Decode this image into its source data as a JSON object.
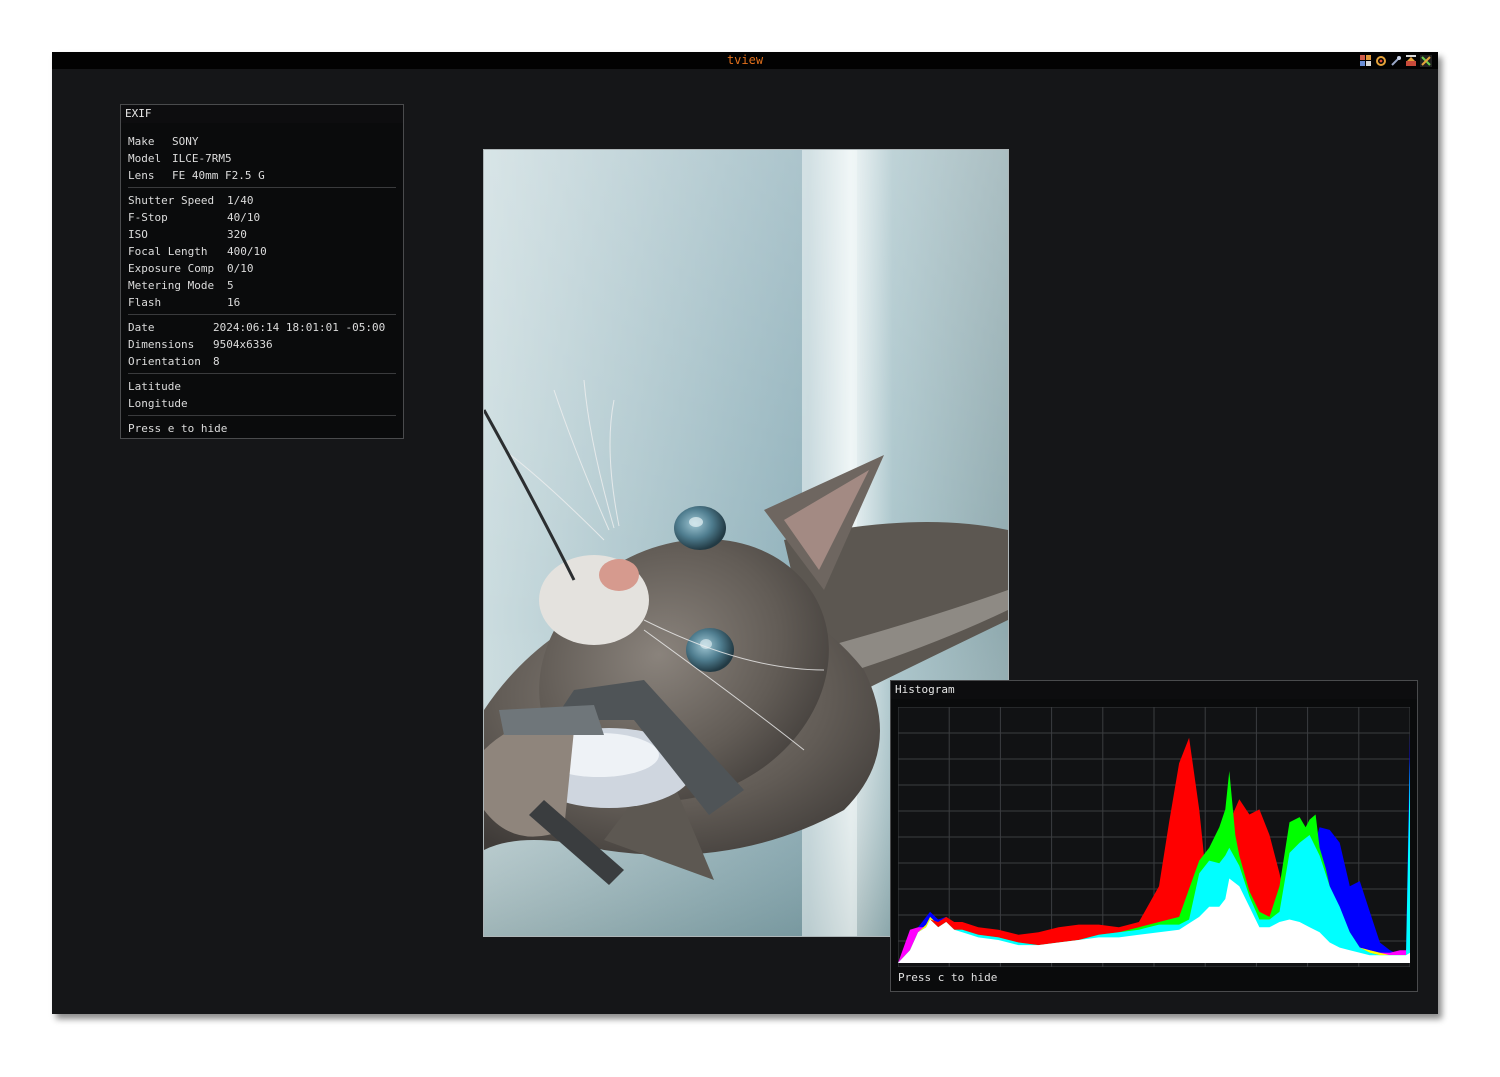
{
  "window": {
    "title": "tview",
    "title_color": "#e2701c",
    "toolbar_icons": [
      "grid-icon",
      "target-icon",
      "pin-icon",
      "maximize-icon",
      "close-icon"
    ]
  },
  "exif": {
    "title": "EXIF",
    "groups": [
      [
        {
          "key": "Make",
          "value": "SONY"
        },
        {
          "key": "Model",
          "value": "ILCE-7RM5"
        },
        {
          "key": "Lens",
          "value": "FE 40mm F2.5 G"
        }
      ],
      [
        {
          "key": "Shutter Speed",
          "value": "1/40"
        },
        {
          "key": "F-Stop",
          "value": "40/10"
        },
        {
          "key": "ISO",
          "value": "320"
        },
        {
          "key": "Focal Length",
          "value": "400/10"
        },
        {
          "key": "Exposure Comp",
          "value": "0/10"
        },
        {
          "key": "Metering Mode",
          "value": "5"
        },
        {
          "key": "Flash",
          "value": "16"
        }
      ],
      [
        {
          "key": "Date",
          "value": "2024:06:14 18:01:01 -05:00"
        },
        {
          "key": "Dimensions",
          "value": "9504x6336"
        },
        {
          "key": "Orientation",
          "value": "8"
        }
      ],
      [
        {
          "key": "Latitude",
          "value": ""
        },
        {
          "key": "Longitude",
          "value": ""
        }
      ]
    ],
    "hint": "Press e to hide"
  },
  "photo": {
    "subject": "cat",
    "colors": {
      "background": "#a9c2c8",
      "fur": "#6b6660",
      "eye": "#4f7d8f",
      "nose": "#d69a8e"
    }
  },
  "histogram": {
    "title": "Histogram",
    "hint": "Press c to hide",
    "chart_data": {
      "type": "area",
      "x_range": [
        0,
        255
      ],
      "y_range": [
        0,
        1
      ],
      "grid": true,
      "series": [
        {
          "color": "#0000ff",
          "x": [
            0,
            6,
            10,
            14,
            16,
            20,
            24,
            28,
            32,
            36,
            40,
            50,
            60,
            70,
            80,
            90,
            100,
            110,
            120,
            130,
            140,
            150,
            160,
            165,
            170,
            175,
            180,
            185,
            190,
            195,
            200,
            205,
            210,
            215,
            220,
            225,
            230,
            235,
            240,
            245,
            250,
            253,
            255
          ],
          "values": [
            0,
            0.06,
            0.14,
            0.18,
            0.2,
            0.17,
            0.18,
            0.15,
            0.15,
            0.14,
            0.13,
            0.11,
            0.09,
            0.08,
            0.09,
            0.1,
            0.12,
            0.12,
            0.13,
            0.15,
            0.15,
            0.22,
            0.35,
            0.36,
            0.4,
            0.55,
            0.54,
            0.46,
            0.3,
            0.3,
            0.32,
            0.4,
            0.53,
            0.52,
            0.47,
            0.3,
            0.32,
            0.2,
            0.08,
            0.05,
            0.03,
            0.04,
            0.9
          ]
        },
        {
          "color": "#ff00ff",
          "x": [
            0,
            6,
            10,
            14,
            16,
            20,
            24,
            28,
            32,
            36,
            40,
            50,
            60,
            70,
            80,
            90,
            100,
            110,
            120,
            130,
            140,
            150,
            160,
            165,
            170,
            175,
            180,
            185,
            190,
            195,
            200,
            205,
            210,
            215,
            220,
            225,
            230,
            235,
            240,
            245,
            250,
            253,
            255
          ],
          "values": [
            0,
            0.13,
            0.14,
            0.14,
            0.17,
            0.14,
            0.16,
            0.13,
            0.13,
            0.12,
            0.11,
            0.1,
            0.08,
            0.07,
            0.08,
            0.09,
            0.11,
            0.11,
            0.12,
            0.14,
            0.14,
            0.18,
            0.3,
            0.32,
            0.36,
            0.37,
            0.35,
            0.32,
            0.24,
            0.2,
            0.18,
            0.17,
            0.16,
            0.15,
            0.13,
            0.1,
            0.06,
            0.05,
            0.04,
            0.04,
            0.05,
            0.05,
            0.1
          ]
        },
        {
          "color": "#ffff00",
          "x": [
            0,
            6,
            10,
            14,
            16,
            20,
            24,
            28,
            32,
            36,
            40,
            50,
            60,
            70,
            80,
            90,
            100,
            110,
            120,
            130,
            140,
            150,
            160,
            165,
            170,
            175,
            180,
            185,
            190,
            195,
            200,
            205,
            210,
            215,
            220,
            225,
            230,
            235,
            240,
            245,
            250,
            253,
            255
          ],
          "values": [
            0,
            0.05,
            0.12,
            0.15,
            0.18,
            0.15,
            0.16,
            0.13,
            0.13,
            0.13,
            0.12,
            0.1,
            0.09,
            0.08,
            0.08,
            0.09,
            0.1,
            0.11,
            0.12,
            0.14,
            0.16,
            0.2,
            0.33,
            0.34,
            0.35,
            0.36,
            0.35,
            0.32,
            0.24,
            0.2,
            0.18,
            0.17,
            0.16,
            0.15,
            0.13,
            0.1,
            0.06,
            0.05,
            0.04,
            0.03,
            0.03,
            0.03,
            0.05
          ]
        },
        {
          "color": "#ff0000",
          "x": [
            0,
            6,
            10,
            14,
            16,
            20,
            24,
            28,
            32,
            36,
            40,
            50,
            60,
            70,
            80,
            90,
            100,
            110,
            120,
            130,
            135,
            140,
            145,
            150,
            152,
            155,
            160,
            165,
            170,
            175,
            180,
            185,
            190,
            195,
            200,
            205,
            210,
            215,
            220,
            225,
            230,
            235,
            240,
            245,
            250,
            253,
            255
          ],
          "values": [
            0,
            0.05,
            0.12,
            0.14,
            0.17,
            0.16,
            0.18,
            0.16,
            0.16,
            0.15,
            0.14,
            0.13,
            0.11,
            0.12,
            0.14,
            0.15,
            0.15,
            0.14,
            0.16,
            0.3,
            0.55,
            0.78,
            0.88,
            0.6,
            0.45,
            0.18,
            0.42,
            0.55,
            0.64,
            0.58,
            0.6,
            0.5,
            0.35,
            0.18,
            0.12,
            0.1,
            0.08,
            0.06,
            0.04,
            0.03,
            0.02,
            0.02,
            0.02,
            0.02,
            0.02,
            0.02,
            0.15
          ]
        },
        {
          "color": "#00ff00",
          "x": [
            0,
            6,
            10,
            14,
            16,
            20,
            24,
            28,
            32,
            36,
            40,
            50,
            60,
            70,
            80,
            90,
            100,
            110,
            120,
            130,
            140,
            150,
            155,
            160,
            163,
            165,
            168,
            170,
            175,
            180,
            185,
            190,
            195,
            200,
            203,
            205,
            208,
            210,
            213,
            215,
            220,
            225,
            230,
            235,
            240,
            245,
            250,
            253,
            255
          ],
          "values": [
            0,
            0.05,
            0.12,
            0.14,
            0.17,
            0.14,
            0.16,
            0.13,
            0.13,
            0.12,
            0.11,
            0.1,
            0.08,
            0.07,
            0.08,
            0.09,
            0.11,
            0.12,
            0.14,
            0.16,
            0.18,
            0.4,
            0.45,
            0.53,
            0.6,
            0.75,
            0.5,
            0.42,
            0.28,
            0.2,
            0.18,
            0.3,
            0.55,
            0.57,
            0.53,
            0.56,
            0.58,
            0.45,
            0.37,
            0.3,
            0.2,
            0.12,
            0.06,
            0.04,
            0.03,
            0.03,
            0.03,
            0.03,
            0.05
          ]
        },
        {
          "color": "#00ffff",
          "x": [
            0,
            6,
            10,
            14,
            16,
            20,
            24,
            28,
            32,
            36,
            40,
            50,
            60,
            70,
            80,
            90,
            100,
            110,
            120,
            130,
            140,
            145,
            150,
            155,
            160,
            163,
            165,
            170,
            175,
            180,
            185,
            190,
            195,
            200,
            205,
            210,
            215,
            220,
            225,
            230,
            235,
            240,
            245,
            250,
            253,
            255
          ],
          "values": [
            0,
            0.05,
            0.12,
            0.14,
            0.17,
            0.14,
            0.16,
            0.13,
            0.13,
            0.12,
            0.11,
            0.1,
            0.08,
            0.07,
            0.08,
            0.09,
            0.11,
            0.12,
            0.13,
            0.15,
            0.15,
            0.17,
            0.35,
            0.4,
            0.39,
            0.42,
            0.45,
            0.38,
            0.26,
            0.17,
            0.17,
            0.2,
            0.43,
            0.47,
            0.5,
            0.42,
            0.3,
            0.22,
            0.12,
            0.06,
            0.04,
            0.03,
            0.03,
            0.03,
            0.03,
            0.8
          ]
        },
        {
          "color": "#ffffff",
          "x": [
            0,
            6,
            10,
            14,
            16,
            20,
            24,
            28,
            32,
            36,
            40,
            50,
            60,
            70,
            80,
            90,
            100,
            110,
            120,
            130,
            140,
            150,
            155,
            160,
            163,
            165,
            170,
            175,
            180,
            185,
            190,
            195,
            200,
            205,
            210,
            215,
            220,
            225,
            230,
            235,
            240,
            245,
            250,
            253,
            255
          ],
          "values": [
            0,
            0.05,
            0.12,
            0.14,
            0.17,
            0.14,
            0.16,
            0.13,
            0.12,
            0.11,
            0.1,
            0.09,
            0.07,
            0.07,
            0.08,
            0.09,
            0.1,
            0.1,
            0.11,
            0.12,
            0.13,
            0.18,
            0.22,
            0.22,
            0.25,
            0.33,
            0.3,
            0.22,
            0.14,
            0.14,
            0.16,
            0.17,
            0.16,
            0.14,
            0.12,
            0.08,
            0.06,
            0.05,
            0.04,
            0.03,
            0.03,
            0.03,
            0.03,
            0.03,
            0.04
          ]
        }
      ]
    }
  }
}
